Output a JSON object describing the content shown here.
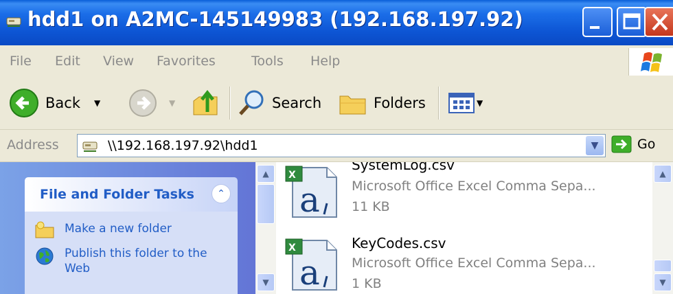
{
  "window": {
    "title": "hdd1 on A2MC-145149983 (192.168.197.92)"
  },
  "menu": {
    "items": [
      "File",
      "Edit",
      "View",
      "Favorites",
      "Tools",
      "Help"
    ]
  },
  "toolbar": {
    "back_label": "Back",
    "search_label": "Search",
    "folders_label": "Folders"
  },
  "address": {
    "label": "Address",
    "value": "\\\\192.168.197.92\\hdd1",
    "go_label": "Go"
  },
  "tasks": {
    "title": "File and Folder Tasks",
    "items": [
      "Make a new folder",
      "Publish this folder to the Web"
    ]
  },
  "files": [
    {
      "name": "SystemLog.csv",
      "type": "Microsoft Office Excel Comma Sepa...",
      "size": "11 KB"
    },
    {
      "name": "KeyCodes.csv",
      "type": "Microsoft Office Excel Comma Sepa...",
      "size": "1 KB"
    }
  ],
  "colors": {
    "titlebar": "#0d55d4",
    "taskpane": "#7ba2e7",
    "link": "#215dc6"
  }
}
